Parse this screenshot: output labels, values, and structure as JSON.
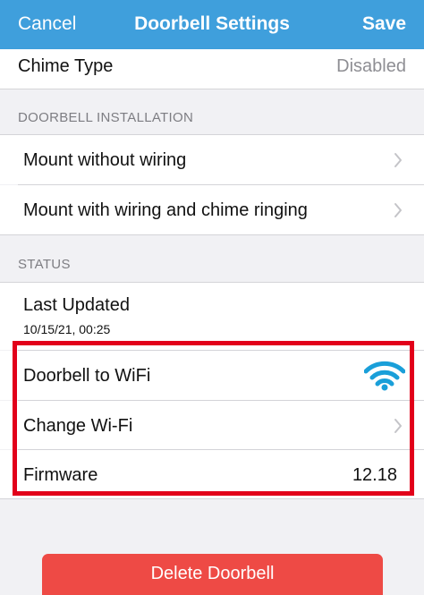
{
  "navbar": {
    "cancel_label": "Cancel",
    "title": "Doorbell Settings",
    "save_label": "Save"
  },
  "chime": {
    "label": "Chime Type",
    "value": "Disabled"
  },
  "installation": {
    "header": "DOORBELL INSTALLATION",
    "items": [
      {
        "label": "Mount without wiring",
        "icon": "chevron-right-icon"
      },
      {
        "label": "Mount with wiring and chime ringing",
        "icon": "chevron-right-icon"
      }
    ]
  },
  "status": {
    "header": "STATUS",
    "last_updated_label": "Last Updated",
    "last_updated_value": "10/15/21, 00:25",
    "wifi_label": "Doorbell to WiFi",
    "wifi_icon": "wifi-signal-icon",
    "wifi_signal_level": 1.0,
    "change_wifi_label": "Change Wi-Fi",
    "firmware_label": "Firmware",
    "firmware_value": "12.18"
  },
  "actions": {
    "delete_label": "Delete Doorbell"
  },
  "colors": {
    "accent": "#3f9fdc",
    "wifi": "#1a9fd9",
    "highlight": "#e2001a",
    "delete": "#ee4a45"
  }
}
